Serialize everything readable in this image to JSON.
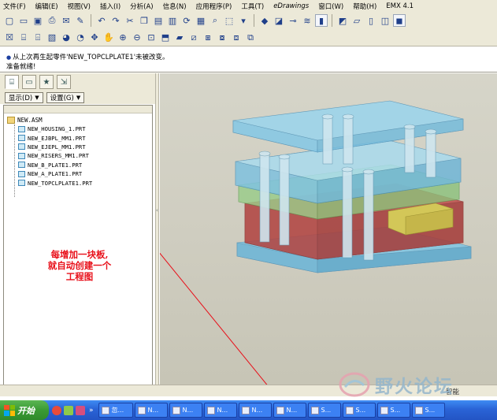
{
  "menubar": {
    "items": [
      {
        "label": "文件(F)"
      },
      {
        "label": "编辑(E)"
      },
      {
        "label": "视图(V)"
      },
      {
        "label": "插入(I)"
      },
      {
        "label": "分析(A)"
      },
      {
        "label": "信息(N)"
      },
      {
        "label": "应用程序(P)"
      },
      {
        "label": "工具(T)"
      },
      {
        "label": "eDrawings"
      },
      {
        "label": "窗口(W)"
      },
      {
        "label": "帮助(H)"
      },
      {
        "label": "EMX 4.1"
      }
    ]
  },
  "messages": {
    "line1": "从上次再生起零件'NEW_TOPCLPLATE1'未被改变。",
    "line2": "准备就绪!"
  },
  "left_panel": {
    "display_button": "显示(D)",
    "settings_button": "设置(G)",
    "tree": {
      "root": "NEW.ASM",
      "items": [
        "NEW_HOUSING_1.PRT",
        "NEW_EJBPL_MM1.PRT",
        "NEW_EJEPL_MM1.PRT",
        "NEW_RISERS_MM1.PRT",
        "NEW_B_PLATE1.PRT",
        "NEW_A_PLATE1.PRT",
        "NEW_TOPCLPLATE1.PRT"
      ]
    }
  },
  "annotation": {
    "line1": "每增加一块板,",
    "line2": "就自动创建一个",
    "line3": "工程图",
    "color": "#e8101a"
  },
  "statusbar": {
    "filter": "智能"
  },
  "watermark": {
    "text": "野火论坛"
  },
  "taskbar": {
    "start_label": "开始",
    "buttons": [
      "忽...",
      "N...",
      "N...",
      "N...",
      "N...",
      "N...",
      "S...",
      "S...",
      "S...",
      "S..."
    ]
  },
  "colors": {
    "plate_blue": "#7fc6e4",
    "plate_green": "#a9d99a",
    "plate_red": "#c0504d",
    "plate_yellow": "#d8d45a",
    "annotation_arrow": "#e8101a"
  }
}
